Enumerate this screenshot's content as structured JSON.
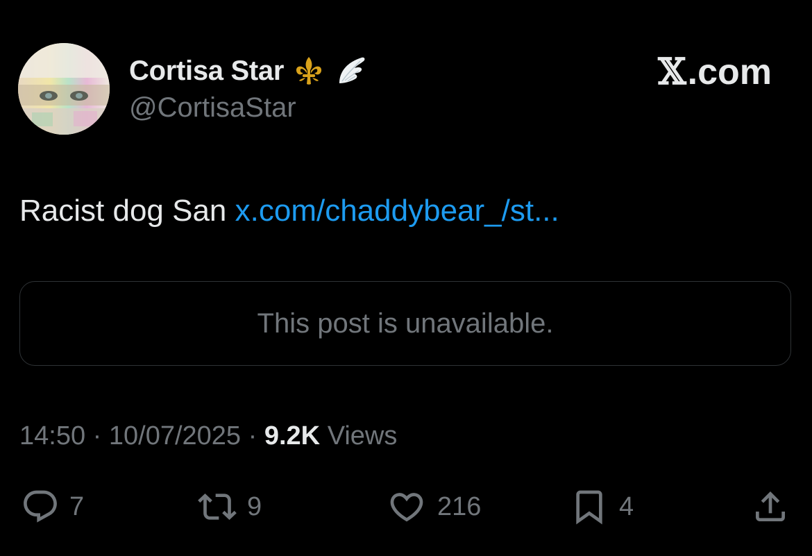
{
  "author": {
    "display_name": "Cortisa Star",
    "handle": "@CortisaStar",
    "name_emojis": [
      "fleur-de-lis-icon",
      "wing-icon"
    ]
  },
  "brand": {
    "glyph": "𝕏",
    "label": ".com"
  },
  "tweet": {
    "text": "Racist dog San",
    "link_text": "x.com/chaddybear_/st..."
  },
  "quote": {
    "text": "This post is unavailable."
  },
  "meta": {
    "time": "14:50",
    "separator": "·",
    "date": "10/07/2025",
    "views_count": "9.2K",
    "views_label": "Views"
  },
  "actions": {
    "replies": "7",
    "reposts": "9",
    "likes": "216",
    "bookmarks": "4"
  },
  "colors": {
    "background": "#000000",
    "text": "#e7e9ea",
    "secondary": "#71767b",
    "link": "#1d9bf0",
    "border": "#2f3336"
  }
}
